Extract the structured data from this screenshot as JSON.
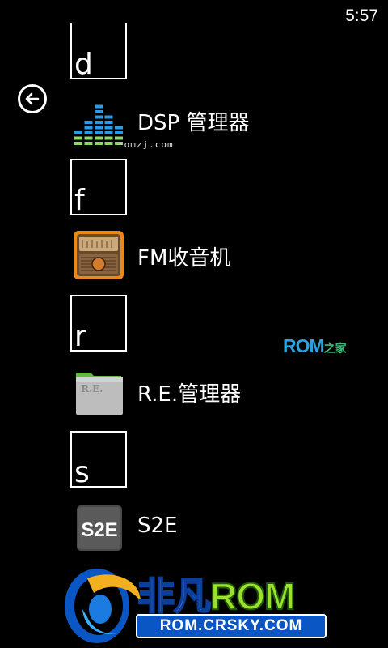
{
  "status_bar": {
    "time": "5:57"
  },
  "groups": [
    {
      "letter": "d",
      "apps": [
        {
          "label": "DSP 管理器",
          "icon": "equalizer-icon"
        }
      ]
    },
    {
      "letter": "f",
      "apps": [
        {
          "label": "FM收音机",
          "icon": "radio-icon"
        }
      ]
    },
    {
      "letter": "r",
      "apps": [
        {
          "label": "R.E.管理器",
          "icon": "folder-icon",
          "icon_text": "R.E."
        }
      ]
    },
    {
      "letter": "s",
      "apps": [
        {
          "label": "S2E",
          "icon": "s2e-icon",
          "icon_text": "S2E"
        }
      ]
    }
  ],
  "watermarks": {
    "small": "romzj.com",
    "rom_main": "ROM",
    "rom_sub": "之家",
    "logo_title_1": "非凡",
    "logo_title_2": "ROM",
    "logo_site": "ROM.CRSKY.COM"
  },
  "colors": {
    "background": "#000000",
    "foreground": "#ffffff",
    "eq_blue": "#2b9be8",
    "eq_green": "#8ed86b",
    "radio_orange": "#e8891a",
    "folder_gray": "#b8b8b8",
    "folder_tab_green": "#66b845"
  }
}
